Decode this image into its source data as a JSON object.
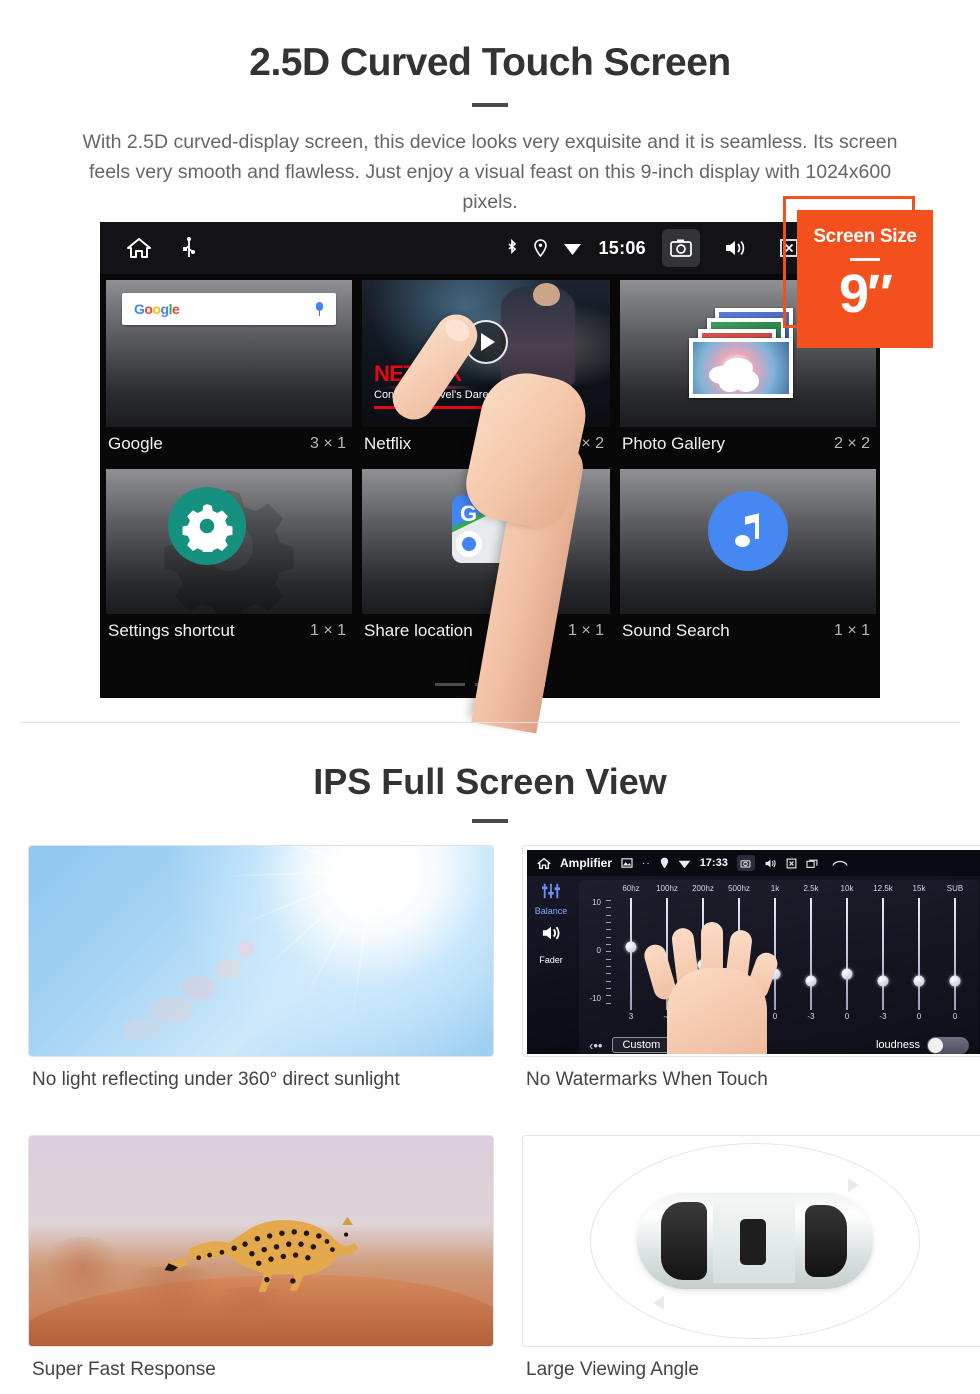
{
  "section1": {
    "title": "2.5D Curved Touch Screen",
    "paragraph": "With 2.5D curved-display screen, this device looks very exquisite and it is seamless. Its screen feels very smooth and flawless. Just enjoy a visual feast on this 9-inch display with 1024x600 pixels.",
    "badge": {
      "label": "Screen Size",
      "value": "9″"
    },
    "device": {
      "statusbar": {
        "time": "15:06",
        "left_icons": [
          "home-icon",
          "usb-icon"
        ],
        "right_icons": [
          "bluetooth-icon",
          "location-icon",
          "wifi-icon",
          "camera-icon",
          "volume-icon",
          "close-box-icon",
          "recents-icon"
        ]
      },
      "widgets": [
        {
          "name": "Google",
          "size": "3 × 1",
          "search_placeholder": "Google"
        },
        {
          "name": "Netflix",
          "size": "3 × 2",
          "brand": "NETFLIX",
          "subtitle": "Continue Marvel's Daredevil"
        },
        {
          "name": "Photo Gallery",
          "size": "2 × 2"
        },
        {
          "name": "Settings shortcut",
          "size": "1 × 1"
        },
        {
          "name": "Share location",
          "size": "1 × 1"
        },
        {
          "name": "Sound Search",
          "size": "1 × 1"
        }
      ],
      "page_dots": {
        "count": 3,
        "active_index": 2
      }
    }
  },
  "section2": {
    "title": "IPS Full Screen View",
    "cards": [
      {
        "caption": "No light reflecting under 360° direct sunlight",
        "image": "sunny-sky"
      },
      {
        "caption": "No Watermarks When Touch",
        "image": "amplifier-equalizer-screen"
      },
      {
        "caption": "Super Fast Response",
        "image": "running-cheetah"
      },
      {
        "caption": "Large Viewing Angle",
        "image": "car-top-view"
      }
    ]
  },
  "amplifier": {
    "title": "Amplifier",
    "time": "17:33",
    "side_tabs": [
      "Balance",
      "Fader"
    ],
    "scale_labels": [
      "10",
      "0",
      "-10"
    ],
    "bands": [
      "60hz",
      "100hz",
      "200hz",
      "500hz",
      "1k",
      "2.5k",
      "10k",
      "12.5k",
      "15k",
      "SUB"
    ],
    "values": [
      "3",
      "-4",
      "0",
      "0",
      "0",
      "-3",
      "0",
      "-3",
      "0",
      "0"
    ],
    "preset_button": "Custom",
    "loudness_label": "loudness",
    "loudness_on": false
  },
  "colors": {
    "accent": "#F4501E",
    "heading": "#333333",
    "body_text": "#666666",
    "netflix_red": "#E50914",
    "settings_green": "#16907F",
    "sound_blue": "#4688F1"
  }
}
